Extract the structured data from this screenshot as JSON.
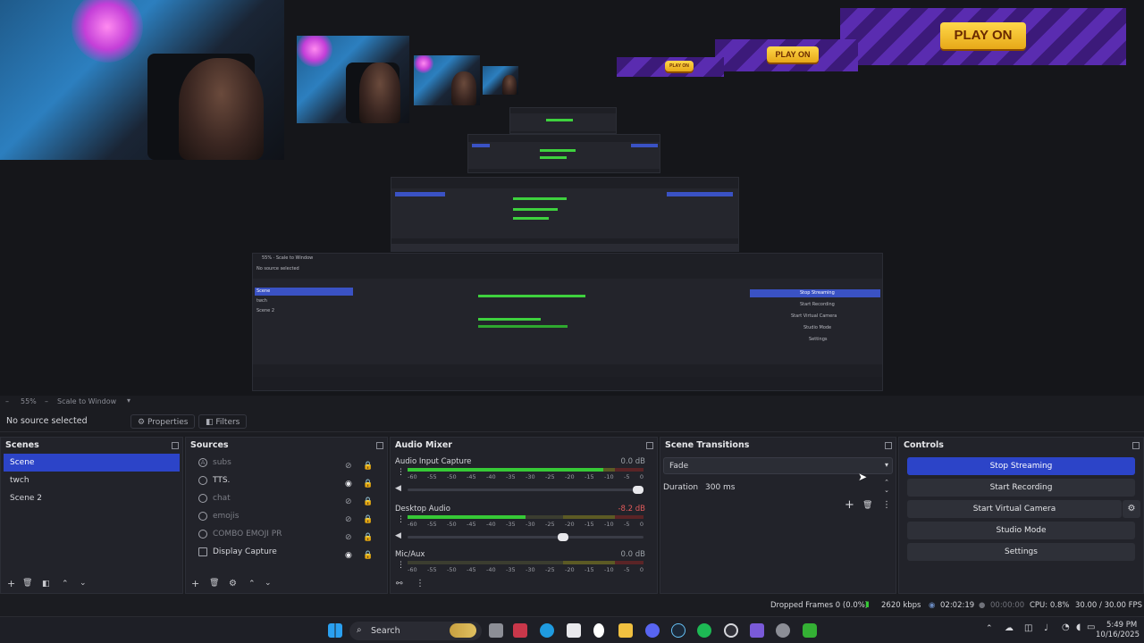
{
  "preview": {
    "banner_text": "PLAY ON",
    "zoom": "55%",
    "scale_mode": "Scale to Window"
  },
  "toolbar": {
    "no_source": "No source selected",
    "properties": "Properties",
    "filters": "Filters"
  },
  "scenes": {
    "title": "Scenes",
    "items": [
      "Scene",
      "twch",
      "Scene 2"
    ]
  },
  "sources": {
    "title": "Sources",
    "items": [
      {
        "label": "subs",
        "icon": "text-icon",
        "visible": false
      },
      {
        "label": "TTS.",
        "icon": "browser-icon",
        "visible": true
      },
      {
        "label": "chat",
        "icon": "browser-icon",
        "visible": false
      },
      {
        "label": "emojis",
        "icon": "browser-icon",
        "visible": false
      },
      {
        "label": "COMBO EMOJI PR",
        "icon": "browser-icon",
        "visible": false
      },
      {
        "label": "Display Capture",
        "icon": "monitor-icon",
        "visible": true
      }
    ]
  },
  "mixer": {
    "title": "Audio Mixer",
    "ticks": [
      "-60",
      "-55",
      "-50",
      "-45",
      "-40",
      "-35",
      "-30",
      "-25",
      "-20",
      "-15",
      "-10",
      "-5",
      "0"
    ],
    "channels": [
      {
        "name": "Audio Input Capture",
        "db": "0.0 dB",
        "db_color": "#9aa0a6",
        "level": 0.83,
        "volume": 1.0
      },
      {
        "name": "Desktop Audio",
        "db": "-8.2 dB",
        "db_color": "#e05a5a",
        "level": 0.5,
        "volume": 0.68
      },
      {
        "name": "Mic/Aux",
        "db": "0.0 dB",
        "db_color": "#9aa0a6",
        "level": 0.0,
        "volume": null
      }
    ]
  },
  "transitions": {
    "title": "Scene Transitions",
    "selected": "Fade",
    "duration_label": "Duration",
    "duration_value": "300 ms"
  },
  "controls": {
    "title": "Controls",
    "stop_streaming": "Stop Streaming",
    "start_recording": "Start Recording",
    "start_virtual_camera": "Start Virtual Camera",
    "studio_mode": "Studio Mode",
    "settings": "Settings"
  },
  "status": {
    "dropped": "Dropped Frames 0 (0.0%)",
    "bitrate": "2620 kbps",
    "stream_time": "02:02:19",
    "rec_time": "00:00:00",
    "cpu": "CPU: 0.8%",
    "fps": "30.00 / 30.00 FPS"
  },
  "taskbar": {
    "search": "Search",
    "time": "5:49 PM",
    "date": "10/16/2025"
  },
  "colors": {
    "accent": "#2c44c8",
    "meter_green": "#36c936"
  }
}
